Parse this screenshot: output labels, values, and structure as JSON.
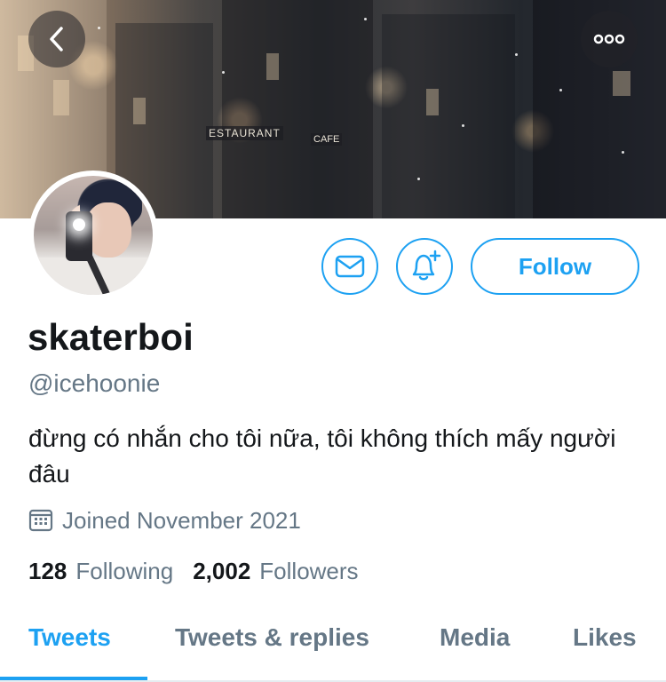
{
  "profile": {
    "display_name": "skaterboi",
    "handle": "@icehoonie",
    "bio": "đừng có nhắn cho tôi nữa, tôi không thích mấy người đâu",
    "joined": "Joined November 2021"
  },
  "actions": {
    "follow_label": "Follow"
  },
  "stats": {
    "following_count": "128",
    "following_label": "Following",
    "followers_count": "2,002",
    "followers_label": "Followers"
  },
  "banner": {
    "sign_text": "ESTAURANT",
    "sign_text_2": "CAFE"
  },
  "tabs": [
    {
      "label": "Tweets",
      "active": true
    },
    {
      "label": "Tweets & replies",
      "active": false
    },
    {
      "label": "Media",
      "active": false
    },
    {
      "label": "Likes",
      "active": false
    }
  ],
  "icons": {
    "back": "chevron-left-icon",
    "more": "ellipsis-icon",
    "message": "envelope-icon",
    "notify": "bell-plus-icon",
    "calendar": "calendar-icon"
  },
  "colors": {
    "accent": "#1da1f2",
    "text_primary": "#14171a",
    "text_secondary": "#657786"
  }
}
